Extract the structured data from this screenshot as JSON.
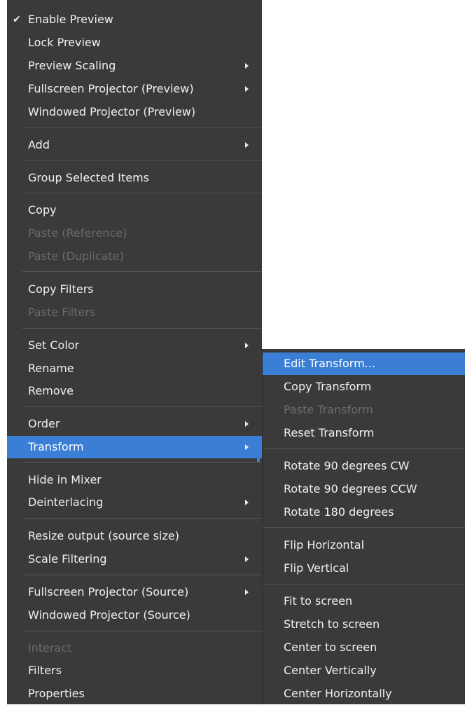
{
  "colors": {
    "menu_bg": "#3a3a3a",
    "highlight": "#3a7fd5",
    "text": "#f0f0f0",
    "disabled_text": "#6b6b6b",
    "separator": "#555555"
  },
  "context_menu": {
    "check_mark": "✔",
    "items": {
      "enable_preview": "Enable Preview",
      "lock_preview": "Lock Preview",
      "preview_scaling": "Preview Scaling",
      "fullscreen_projector_preview": "Fullscreen Projector (Preview)",
      "windowed_projector_preview": "Windowed Projector (Preview)",
      "add": "Add",
      "group_selected_items": "Group Selected Items",
      "copy": "Copy",
      "paste_reference": "Paste (Reference)",
      "paste_duplicate": "Paste (Duplicate)",
      "copy_filters": "Copy Filters",
      "paste_filters": "Paste Filters",
      "set_color": "Set Color",
      "rename": "Rename",
      "remove": "Remove",
      "order": "Order",
      "transform": "Transform",
      "hide_in_mixer": "Hide in Mixer",
      "deinterlacing": "Deinterlacing",
      "resize_output": "Resize output (source size)",
      "scale_filtering": "Scale Filtering",
      "fullscreen_projector_source": "Fullscreen Projector (Source)",
      "windowed_projector_source": "Windowed Projector (Source)",
      "interact": "Interact",
      "filters": "Filters",
      "properties": "Properties"
    }
  },
  "transform_submenu": {
    "items": {
      "edit_transform": "Edit Transform...",
      "copy_transform": "Copy Transform",
      "paste_transform": "Paste Transform",
      "reset_transform": "Reset Transform",
      "rotate_cw": "Rotate 90 degrees CW",
      "rotate_ccw": "Rotate 90 degrees CCW",
      "rotate_180": "Rotate 180 degrees",
      "flip_horizontal": "Flip Horizontal",
      "flip_vertical": "Flip Vertical",
      "fit_to_screen": "Fit to screen",
      "stretch_to_screen": "Stretch to screen",
      "center_to_screen": "Center to screen",
      "center_vertically": "Center Vertically",
      "center_horizontally": "Center Horizontally"
    }
  }
}
